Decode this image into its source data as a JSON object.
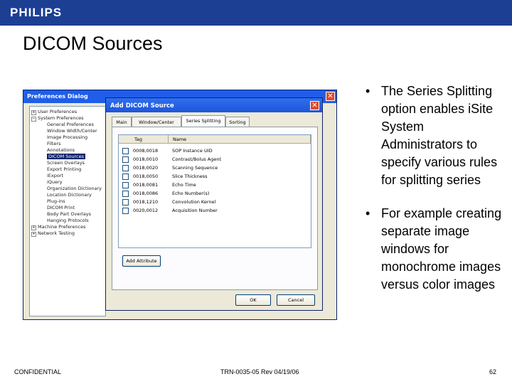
{
  "header": {
    "logo": "PHILIPS",
    "title": "DICOM Sources"
  },
  "bullets": [
    "The Series Splitting option enables iSite System Administrators to specify various rules for splitting series",
    "For example creating separate image windows for monochrome images versus color images"
  ],
  "footer": {
    "left": "CONFIDENTIAL",
    "center": "TRN-0035-05 Rev 04/19/06",
    "page": "62"
  },
  "colors": {
    "brand_bar": "#1c3f94",
    "titlebar": "#1f5ee8"
  },
  "prefs_dialog": {
    "title": "Preferences Dialog",
    "tree": [
      "User Preferences",
      "System Preferences",
      "General Preferences",
      "Window Width/Center",
      "Image Processing",
      "Filters",
      "Annotations",
      "DICOM Sources",
      "Screen Overlays",
      "Export Printing",
      "iExport",
      "iQuery",
      "Organization Dictionary",
      "Location Dictionary",
      "Plug-ins",
      "DICOM Print",
      "Body Part Overlays",
      "Hanging Protocols",
      "Machine Preferences",
      "Network Testing"
    ],
    "selected_item": "DICOM Sources"
  },
  "add_dialog": {
    "title": "Add DICOM Source",
    "tabs": [
      "Main",
      "Window/Center",
      "Series Splitting",
      "Sorting"
    ],
    "active_tab": "Series Splitting",
    "columns": [
      "Tag",
      "Name"
    ],
    "rows": [
      {
        "tag": "0008,0018",
        "name": "SOP Instance UID"
      },
      {
        "tag": "0018,0010",
        "name": "Contrast/Bolus Agent"
      },
      {
        "tag": "0018,0020",
        "name": "Scanning Sequence"
      },
      {
        "tag": "0018,0050",
        "name": "Slice Thickness"
      },
      {
        "tag": "0018,0081",
        "name": "Echo Time"
      },
      {
        "tag": "0018,0086",
        "name": "Echo Number(s)"
      },
      {
        "tag": "0018,1210",
        "name": "Convolution Kernel"
      },
      {
        "tag": "0020,0012",
        "name": "Acquisition Number"
      }
    ],
    "add_button": "Add Attribute",
    "ok_button": "OK",
    "cancel_button": "Cancel"
  }
}
